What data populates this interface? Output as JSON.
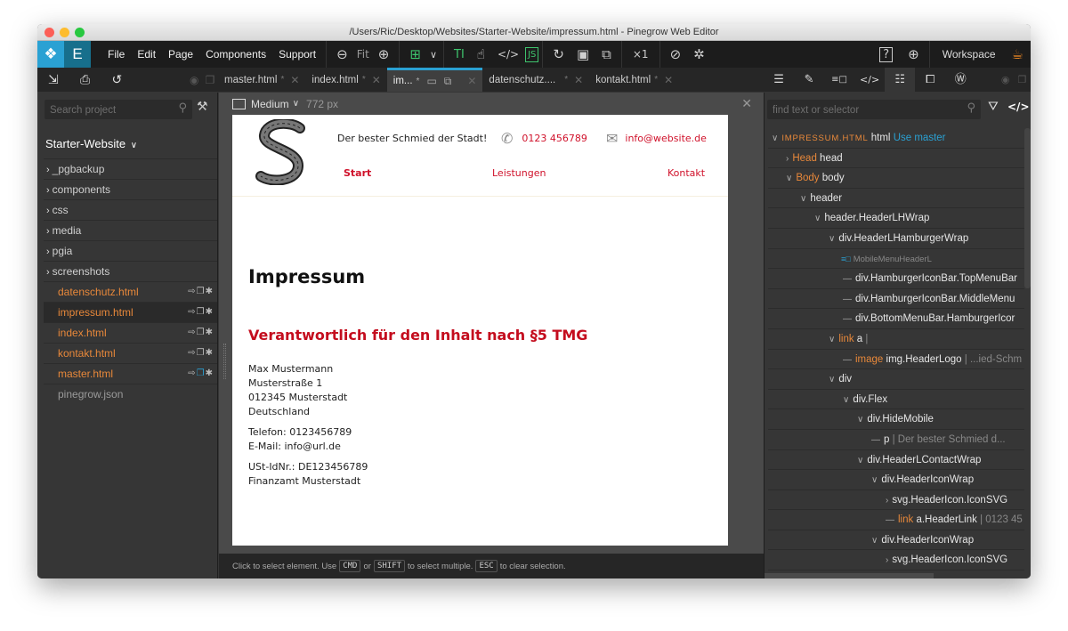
{
  "window": {
    "title": "/Users/Ric/Desktop/Websites/Starter-Website/impressum.html - Pinegrow Web Editor"
  },
  "menubar": {
    "items": [
      "File",
      "Edit",
      "Page",
      "Components",
      "Support"
    ],
    "zoom_fit": "Fit",
    "multiplier": "×1",
    "workspace": "Workspace"
  },
  "tabs": [
    {
      "label": "master.html",
      "modified": "*"
    },
    {
      "label": "index.html",
      "modified": "*"
    },
    {
      "label": "im...",
      "modified": "*",
      "active": true
    },
    {
      "label": "datenschutz....",
      "modified": "*"
    },
    {
      "label": "kontakt.html",
      "modified": "*"
    }
  ],
  "left_panel": {
    "search_placeholder": "Search project",
    "project_title": "Starter-Website",
    "folders": [
      "_pgbackup",
      "components",
      "css",
      "media",
      "pgia",
      "screenshots"
    ],
    "files": [
      {
        "name": "datenschutz.html"
      },
      {
        "name": "impressum.html",
        "selected": true
      },
      {
        "name": "index.html"
      },
      {
        "name": "kontakt.html"
      },
      {
        "name": "master.html",
        "is_master": true
      },
      {
        "name": "pinegrow.json"
      }
    ]
  },
  "canvas": {
    "device": "Medium",
    "width_label": "772 px"
  },
  "site": {
    "tagline": "Der bester Schmied der Stadt!",
    "phone": "0123 456789",
    "email": "info@website.de",
    "nav": [
      "Start",
      "Leistungen",
      "Kontakt"
    ],
    "heading": "Impressum",
    "subheading": "Verantwortlich für den Inhalt nach §5 TMG",
    "address": [
      "Max Mustermann",
      "Musterstraße 1",
      "012345 Musterstadt",
      "Deutschland"
    ],
    "contact": [
      "Telefon: 0123456789",
      "E-Mail: info@url.de"
    ],
    "tax": [
      "USt-IdNr.: DE123456789",
      "Finanzamt Musterstadt"
    ],
    "accent_color": "#c40d1e"
  },
  "statusbar": {
    "part1": "Click to select element. Use",
    "key1": "CMD",
    "part2": "or",
    "key2": "SHIFT",
    "part3": "to select multiple.",
    "key3": "ESC",
    "part4": "to clear selection."
  },
  "right_panel": {
    "search_placeholder": "find text or selector",
    "tree": {
      "root_file": "IMPRESSUM.HTML",
      "root_tag": "html",
      "root_action": "Use master",
      "head_label": "Head",
      "head_tag": "head",
      "body_label": "Body",
      "body_tag": "body",
      "n_header": "header",
      "n_headerwrap": "header.HeaderLHWrap",
      "n_hamburgerwrap": "div.HeaderLHamburgerWrap",
      "n_component": "MobileMenuHeaderL",
      "n_topbar": "div.HamburgerIconBar.TopMenuBar",
      "n_middlebar": "div.HamburgerIconBar.MiddleMenu",
      "n_bottombar": "div.BottomMenuBar.HamburgerIcor",
      "link_label": "link",
      "link_tag": "a",
      "link_sep": "|",
      "image_label": "image",
      "image_tag": "img.HeaderLogo",
      "image_text": "| ...ied-Schm",
      "n_div": "div",
      "n_flex": "div.Flex",
      "n_hidemobile": "div.HideMobile",
      "p_tag": "p",
      "p_text": "| Der bester Schmied d...",
      "n_contactwrap": "div.HeaderLContactWrap",
      "n_iconwrap1": "div.HeaderIconWrap",
      "n_svg1": "svg.HeaderIcon.IconSVG",
      "link2_label": "link",
      "link2_tag": "a.HeaderLink",
      "link2_text": "| 0123 45",
      "n_iconwrap2": "div.HeaderIconWrap",
      "n_svg2": "svg.HeaderIcon.IconSVG"
    }
  }
}
